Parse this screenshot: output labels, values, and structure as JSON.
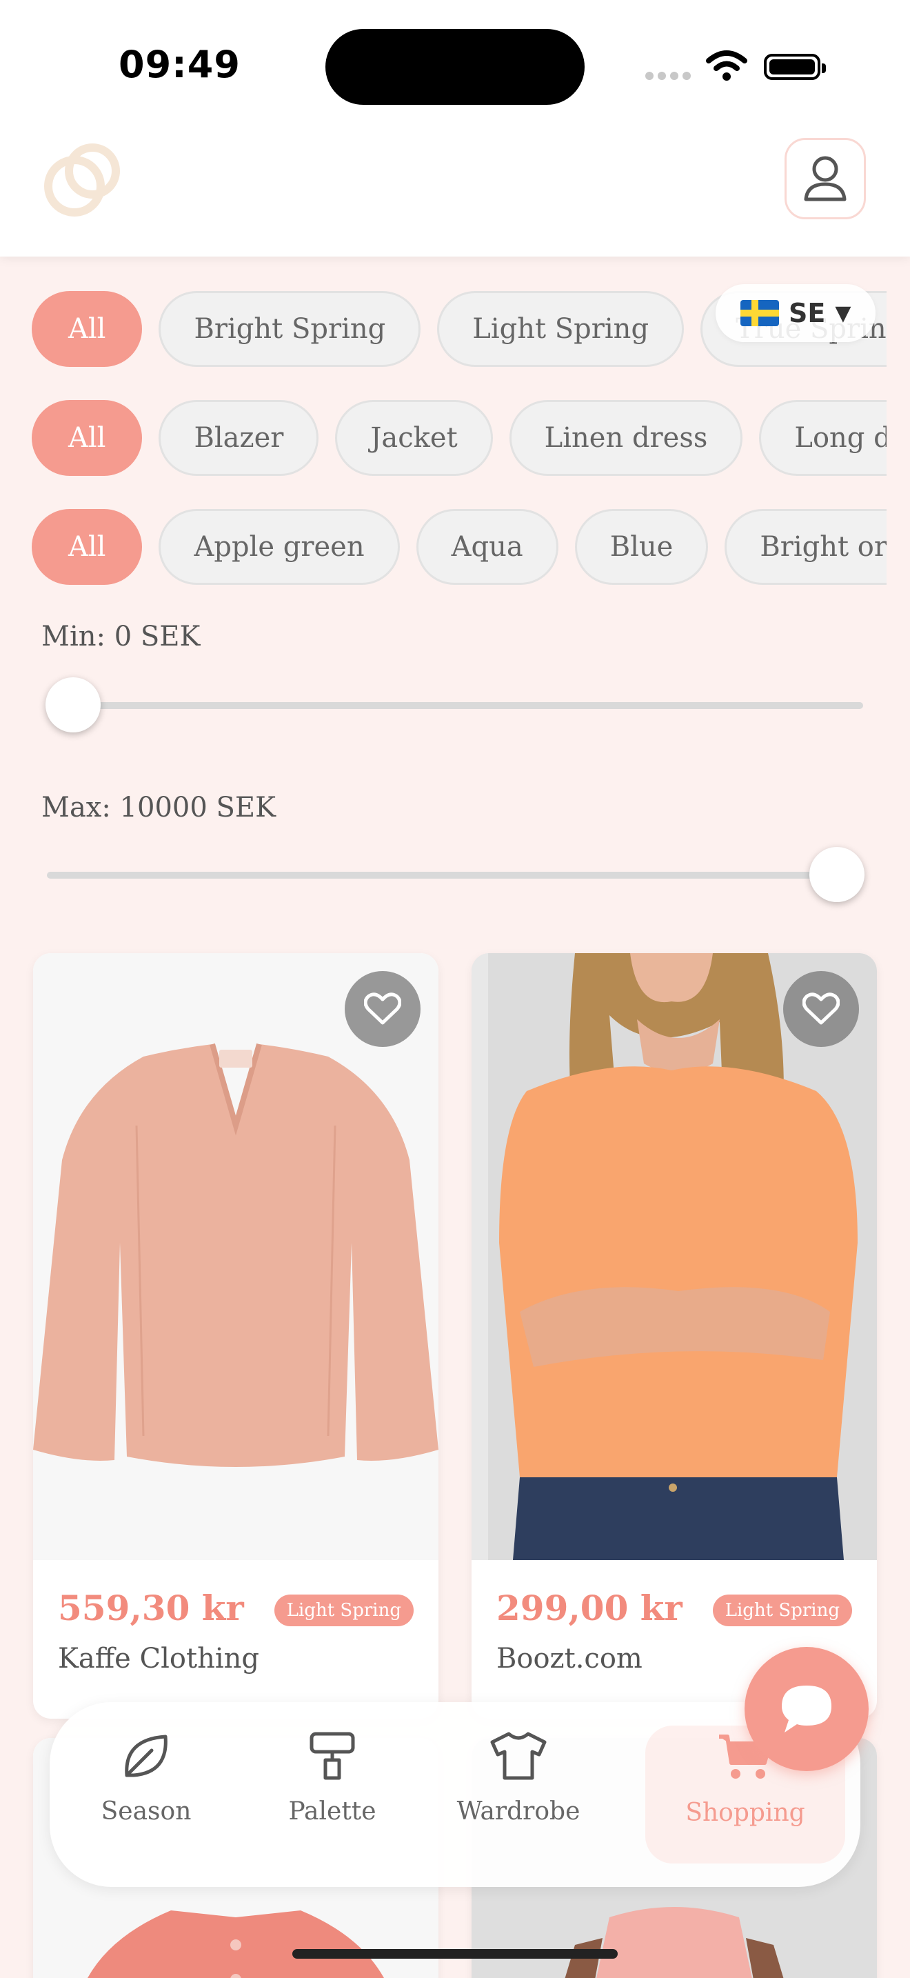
{
  "status_bar": {
    "time": "09:49"
  },
  "header": {
    "logo_icon": "rings-logo-icon",
    "profile_icon": "user-icon"
  },
  "language": {
    "flag_icon": "sweden-flag-icon",
    "code": "SE",
    "caret": "▼"
  },
  "season_chips": [
    {
      "label": "All",
      "active": true
    },
    {
      "label": "Bright Spring",
      "active": false
    },
    {
      "label": "Light Spring",
      "active": false
    },
    {
      "label": "True Spring",
      "active": false
    }
  ],
  "category_chips": [
    {
      "label": "All",
      "active": true
    },
    {
      "label": "Blazer",
      "active": false
    },
    {
      "label": "Jacket",
      "active": false
    },
    {
      "label": "Linen dress",
      "active": false
    },
    {
      "label": "Long dress",
      "active": false
    }
  ],
  "color_chips": [
    {
      "label": "All",
      "active": true
    },
    {
      "label": "Apple green",
      "active": false
    },
    {
      "label": "Aqua",
      "active": false
    },
    {
      "label": "Blue",
      "active": false
    },
    {
      "label": "Bright orange",
      "active": false
    }
  ],
  "price_filter": {
    "min_label": "Min: 0 SEK",
    "max_label": "Max: 10000 SEK",
    "min_value": 0,
    "max_value": 10000
  },
  "products": [
    {
      "price": "559,30 kr",
      "season_tag": "Light Spring",
      "store": "Kaffe Clothing",
      "favorite_icon": "heart-icon"
    },
    {
      "price": "299,00 kr",
      "season_tag": "Light Spring",
      "store": "Boozt.com",
      "favorite_icon": "heart-icon"
    }
  ],
  "chat": {
    "icon": "chat-bubble-icon"
  },
  "bottom_nav": [
    {
      "label": "Season",
      "icon": "leaf-icon",
      "active": false
    },
    {
      "label": "Palette",
      "icon": "paint-roller-icon",
      "active": false
    },
    {
      "label": "Wardrobe",
      "icon": "tshirt-icon",
      "active": false
    },
    {
      "label": "Shopping",
      "icon": "shopping-cart-icon",
      "active": true
    }
  ],
  "colors": {
    "accent": "#f59b8f",
    "background": "#fdf1ef",
    "chip_bg": "#f1f1f1"
  }
}
